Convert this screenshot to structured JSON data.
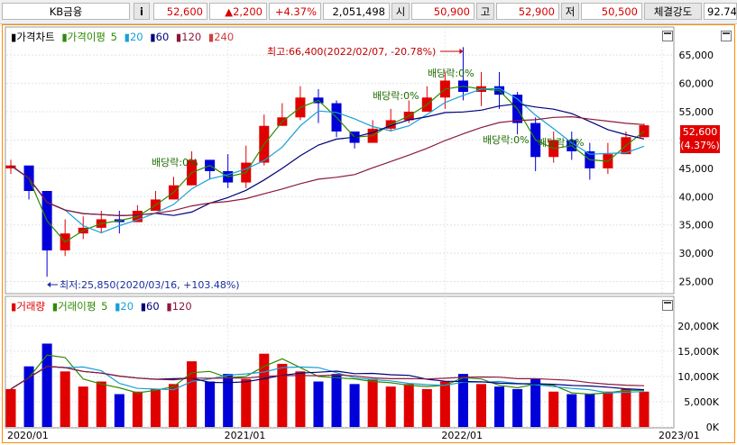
{
  "toolbar": {
    "stock_name": "KB금융",
    "info_label": "i",
    "price": "52,600",
    "change": "▲2,200",
    "change_pct": "+4.37%",
    "volume": "2,051,498",
    "open_label": "시",
    "open": "50,900",
    "high_label": "고",
    "high": "52,900",
    "low_label": "저",
    "low": "50,500",
    "strength_label": "체결강도",
    "strength": "92.74"
  },
  "price_panel": {
    "legend": {
      "title": "가격차트",
      "ma_label": "가격이평",
      "ma5": "5",
      "ma20": "20",
      "ma60": "60",
      "ma120": "120",
      "ma240": "240"
    },
    "current_price_tag": "52,600",
    "current_pct_tag": "(4.37%)",
    "annotations": {
      "high": "최고:66,400(2022/02/07, -20.78%)",
      "low": "최저:25,850(2020/03/16, +103.48%)",
      "div1": "배당락:0%",
      "div2": "배당락:0%",
      "div3": "배당락:0%",
      "div4": "배당락:0%",
      "div5": "배당락:0%"
    },
    "y_labels": [
      "65,000",
      "60,000",
      "55,000",
      "50,000",
      "45,000",
      "40,000",
      "35,000",
      "30,000",
      "25,000"
    ]
  },
  "volume_panel": {
    "legend": {
      "title": "거래량",
      "ma_label": "거래이평",
      "ma5": "5",
      "ma20": "20",
      "ma60": "60",
      "ma120": "120"
    },
    "y_labels": [
      "20,000K",
      "15,000K",
      "10,000K",
      "5,000K",
      "0K"
    ]
  },
  "x_labels": [
    "2020/01",
    "2021/01",
    "2022/01",
    "2023/01"
  ],
  "colors": {
    "up": "#e00000",
    "down": "#0000d8",
    "ma5": "#2e8b00",
    "ma20": "#1a9fd6",
    "ma60": "#00007a",
    "ma120": "#8b1a3a",
    "ma240": "#d04040",
    "frame": "#ff8a00"
  },
  "chart_data": [
    {
      "type": "candlestick",
      "title": "가격차트",
      "ylim": [
        23500,
        69000
      ],
      "x": [
        "2020/01",
        "2020/02",
        "2020/03",
        "2020/04",
        "2020/05",
        "2020/06",
        "2020/07",
        "2020/08",
        "2020/09",
        "2020/10",
        "2020/11",
        "2020/12",
        "2021/01",
        "2021/02",
        "2021/03",
        "2021/04",
        "2021/05",
        "2021/06",
        "2021/07",
        "2021/08",
        "2021/09",
        "2021/10",
        "2021/11",
        "2021/12",
        "2022/01",
        "2022/02",
        "2022/03",
        "2022/04",
        "2022/05",
        "2022/06",
        "2022/07",
        "2022/08",
        "2022/09",
        "2022/10",
        "2022/11",
        "2022/12"
      ],
      "close": [
        45500,
        41000,
        30500,
        33500,
        34500,
        36000,
        35500,
        37500,
        39500,
        42000,
        46500,
        44500,
        42500,
        46000,
        52500,
        54000,
        57500,
        56500,
        51500,
        49500,
        52000,
        53500,
        55000,
        57500,
        60500,
        58500,
        59500,
        58000,
        53000,
        47000,
        50000,
        48000,
        45000,
        47500,
        50500,
        52600
      ],
      "high": [
        46500,
        45000,
        36000,
        36000,
        36500,
        37500,
        37500,
        38500,
        41000,
        43500,
        48000,
        46500,
        47500,
        49000,
        54500,
        56500,
        59500,
        59000,
        57000,
        51500,
        53500,
        55500,
        57000,
        59500,
        62000,
        66400,
        62000,
        62000,
        58500,
        54000,
        51500,
        51500,
        49500,
        49500,
        51500,
        52900
      ],
      "low": [
        44000,
        39500,
        25850,
        29500,
        32500,
        33500,
        33500,
        35500,
        37500,
        39500,
        42000,
        43000,
        41500,
        41500,
        45500,
        52500,
        53500,
        53000,
        50500,
        48500,
        49500,
        51500,
        53000,
        55000,
        55500,
        57000,
        56000,
        55500,
        51000,
        44500,
        46000,
        46500,
        43000,
        44000,
        47500,
        50500
      ]
    },
    {
      "type": "bar",
      "title": "거래량",
      "ylim": [
        0,
        23000
      ],
      "x": [
        "2020/01",
        "2020/02",
        "2020/03",
        "2020/04",
        "2020/05",
        "2020/06",
        "2020/07",
        "2020/08",
        "2020/09",
        "2020/10",
        "2020/11",
        "2020/12",
        "2021/01",
        "2021/02",
        "2021/03",
        "2021/04",
        "2021/05",
        "2021/06",
        "2021/07",
        "2021/08",
        "2021/09",
        "2021/10",
        "2021/11",
        "2021/12",
        "2022/01",
        "2022/02",
        "2022/03",
        "2022/04",
        "2022/05",
        "2022/06",
        "2022/07",
        "2022/08",
        "2022/09",
        "2022/10",
        "2022/11",
        "2022/12"
      ],
      "values": [
        7500,
        12000,
        16500,
        11000,
        8000,
        9000,
        6500,
        7000,
        7500,
        8500,
        13000,
        9000,
        10500,
        9500,
        14500,
        12500,
        11000,
        9000,
        10500,
        8500,
        9500,
        8000,
        8500,
        7500,
        9000,
        10500,
        8500,
        8000,
        7500,
        9500,
        7000,
        6500,
        6500,
        7000,
        7500,
        7000
      ]
    }
  ]
}
